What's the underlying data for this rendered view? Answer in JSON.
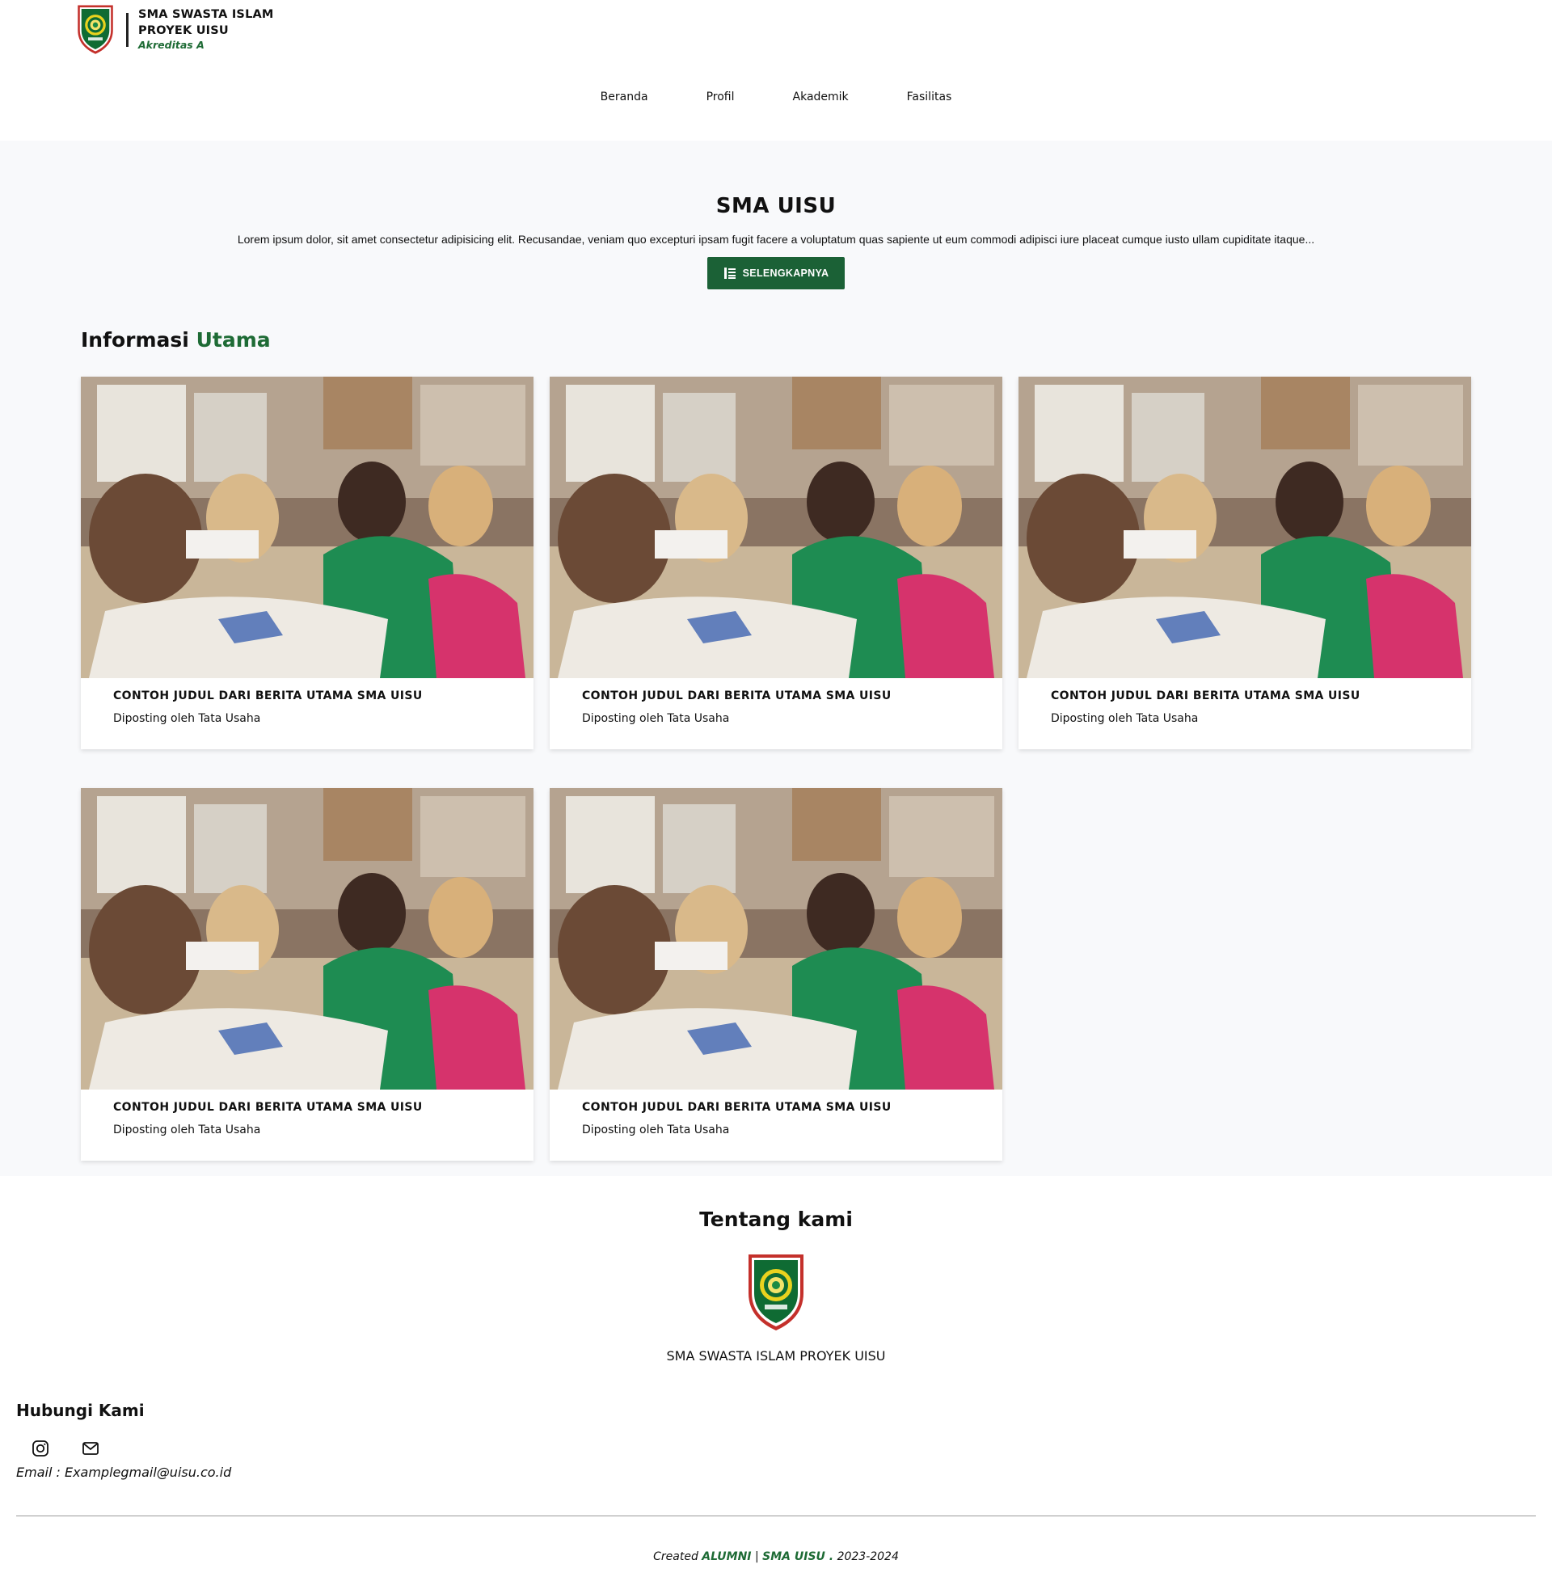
{
  "header": {
    "school_name": "SMA SWASTA ISLAM PROYEK UISU",
    "accreditation": "Akreditas A"
  },
  "nav": {
    "items": [
      "Beranda",
      "Profil",
      "Akademik",
      "Fasilitas"
    ]
  },
  "hero": {
    "title": "SMA UISU",
    "description": "Lorem ipsum dolor, sit amet consectetur adipisicing elit. Recusandae, veniam quo excepturi ipsam fugit facere a voluptatum quas sapiente ut eum commodi adipisci iure placeat cumque iusto ullam cupiditate itaque...",
    "button_label": "SELENGKAPNYA",
    "button_icon": "list-icon"
  },
  "info": {
    "title_part1": "Informasi",
    "title_part2": "Utama",
    "cards": [
      {
        "title": "CONTOH JUDUL DARI BERITA UTAMA SMA UISU",
        "meta": "Diposting oleh Tata Usaha"
      },
      {
        "title": "CONTOH JUDUL DARI BERITA UTAMA SMA UISU",
        "meta": "Diposting oleh Tata Usaha"
      },
      {
        "title": "CONTOH JUDUL DARI BERITA UTAMA SMA UISU",
        "meta": "Diposting oleh Tata Usaha"
      },
      {
        "title": "CONTOH JUDUL DARI BERITA UTAMA SMA UISU",
        "meta": "Diposting oleh Tata Usaha"
      },
      {
        "title": "CONTOH JUDUL DARI BERITA UTAMA SMA UISU",
        "meta": "Diposting oleh Tata Usaha"
      }
    ]
  },
  "about": {
    "title": "Tentang kami",
    "name": "SMA SWASTA ISLAM PROYEK UISU"
  },
  "contact": {
    "title": "Hubungi Kami",
    "icons": [
      "instagram-icon",
      "mail-icon"
    ],
    "email": "Email : Examplegmail@uisu.co.id"
  },
  "footer": {
    "created": "Created",
    "alumni": "ALUMNI",
    "sep": "|",
    "school": "SMA UISU",
    "dot": ".",
    "years": "2023-2024"
  },
  "colors": {
    "brand_green": "#1b6136",
    "accent_green": "#1e6b35",
    "band_bg": "#f8f9fb"
  }
}
